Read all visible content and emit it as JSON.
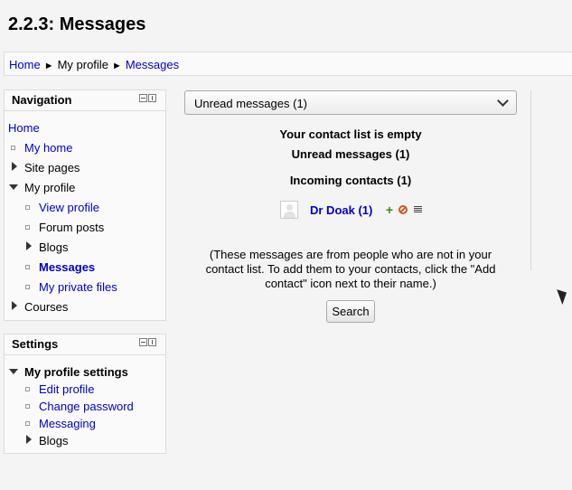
{
  "page": {
    "title": "2.2.3: Messages"
  },
  "breadcrumb": {
    "home": "Home",
    "sep": "►",
    "profile": "My profile",
    "messages": "Messages"
  },
  "navigation": {
    "title": "Navigation",
    "home": "Home",
    "my_home": "My home",
    "site_pages": "Site pages",
    "my_profile": "My profile",
    "view_profile": "View profile",
    "forum_posts": "Forum posts",
    "blogs": "Blogs",
    "messages": "Messages",
    "private_files": "My private files",
    "courses": "Courses"
  },
  "settings": {
    "title": "Settings",
    "profile_settings": "My profile settings",
    "edit_profile": "Edit profile",
    "change_password": "Change password",
    "messaging": "Messaging",
    "blogs": "Blogs"
  },
  "main": {
    "select_value": "Unread messages (1)",
    "contact_empty": "Your contact list is empty",
    "unread_heading": "Unread messages (1)",
    "incoming_heading": "Incoming contacts (1)",
    "contact_name": "Dr Doak (1)",
    "note": "(These messages are from people who are not in your contact list. To add them to your contacts, click the \"Add contact\" icon next to their name.)",
    "search_button": "Search"
  },
  "icons": [
    "add-contact-icon",
    "block-contact-icon",
    "message-history-icon",
    "avatar-icon"
  ]
}
